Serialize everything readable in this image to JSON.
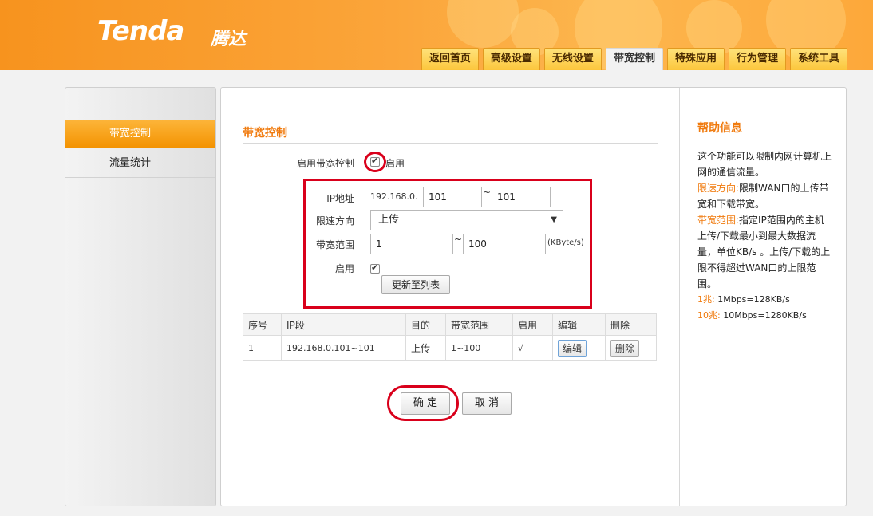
{
  "header": {
    "logo": "Tenda",
    "logo_cn": "腾达",
    "nav": [
      "返回首页",
      "高级设置",
      "无线设置",
      "带宽控制",
      "特殊应用",
      "行为管理",
      "系统工具"
    ],
    "active_nav": "带宽控制"
  },
  "sidebar": {
    "items": [
      "带宽控制",
      "流量统计"
    ]
  },
  "main": {
    "title": "带宽控制",
    "enable_label": "启用带宽控制",
    "enable_text": "启用",
    "form": {
      "ip_label": "IP地址",
      "ip_prefix": "192.168.0.",
      "ip_start": "101",
      "tilde": "~",
      "ip_end": "101",
      "direction_label": "限速方向",
      "direction_value": "上传",
      "range_label": "带宽范围",
      "range_min": "1",
      "range_max": "100",
      "unit": "(KByte/s)",
      "enable_label": "启用",
      "update_button": "更新至列表"
    },
    "table": {
      "headers": [
        "序号",
        "IP段",
        "目的",
        "带宽范围",
        "启用",
        "编辑",
        "删除"
      ],
      "rows": [
        [
          "1",
          "192.168.0.101~101",
          "上传",
          "1~100",
          "√",
          "编辑",
          "删除"
        ]
      ]
    },
    "ok_button": "确 定",
    "cancel_button": "取 消"
  },
  "help": {
    "title": "帮助信息",
    "intro": "这个功能可以限制内网计算机上网的通信流量。",
    "direction_term": "限速方向:",
    "direction_desc": "限制WAN口的上传带宽和下载带宽。",
    "range_term": "带宽范围:",
    "range_desc": "指定IP范围内的主机上传/下载最小到最大数据流量，单位KB/s 。上传/下载的上限不得超过WAN口的上限范围。",
    "note1_term": "1兆:",
    "note1": "1Mbps=128KB/s",
    "note2_term": "10兆:",
    "note2": "10Mbps=1280KB/s"
  },
  "colors": {
    "accent": "#f07b0f",
    "header_orange": "#f7931e",
    "annotation_red": "#d9001b"
  }
}
